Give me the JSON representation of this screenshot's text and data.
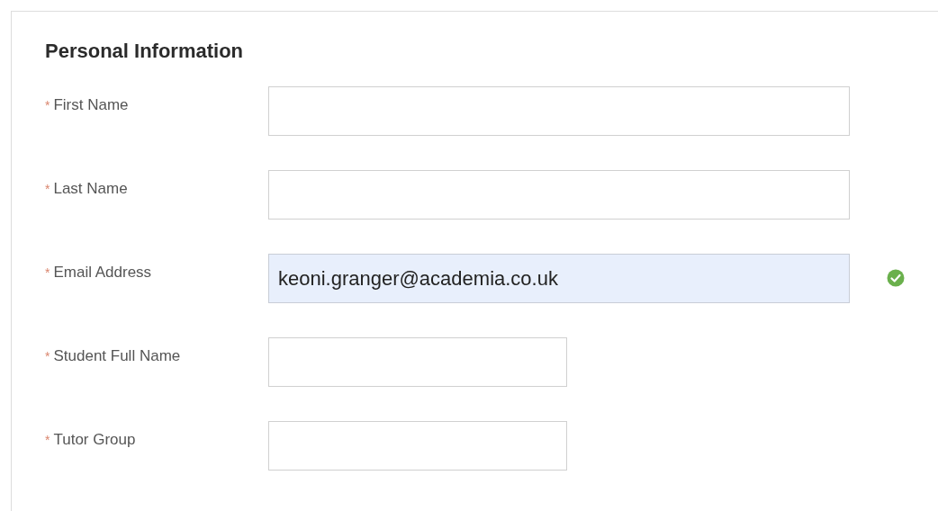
{
  "section": {
    "title": "Personal Information"
  },
  "fields": [
    {
      "label": "First Name",
      "required_mark": "*",
      "kind": "wide",
      "autofilled": false,
      "valid": false
    },
    {
      "label": "Last Name",
      "required_mark": "*",
      "kind": "wide",
      "autofilled": false,
      "valid": false
    },
    {
      "label": "Email Address",
      "required_mark": "*",
      "value": "keoni.granger@academia.co.uk",
      "kind": "wide",
      "autofilled": true,
      "valid": true
    },
    {
      "label": "Student Full Name",
      "required_mark": "*",
      "kind": "short",
      "autofilled": false,
      "valid": false
    },
    {
      "label": "Tutor Group",
      "required_mark": "*",
      "kind": "short",
      "autofilled": false,
      "valid": false
    }
  ]
}
